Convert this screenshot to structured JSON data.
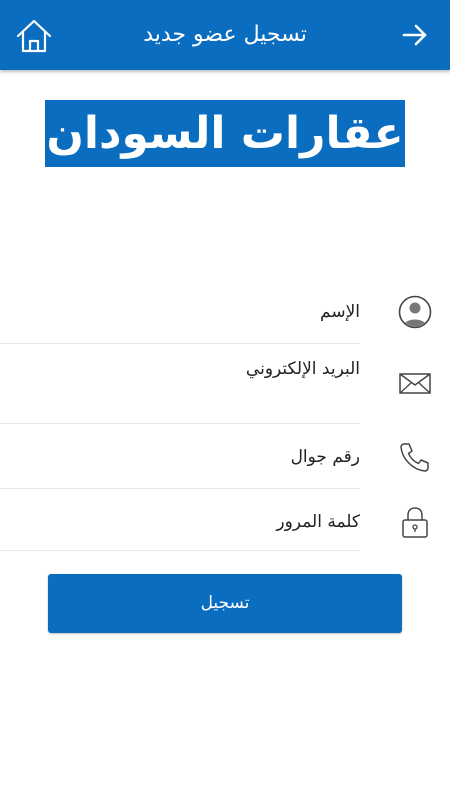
{
  "header": {
    "title": "تسجيل عضو جديد",
    "home_icon": "home-icon",
    "back_icon": "arrow-right-icon",
    "background_color": "#0a6dbf"
  },
  "logo": {
    "text": "عقارات السودان"
  },
  "form": {
    "name_label": "الإسم",
    "email_label": "البريد الإلكتروني",
    "phone_label": "رقم جوال",
    "password_label": "كلمة المرور",
    "icons": {
      "name": "person-avatar-icon",
      "email": "envelope-icon",
      "phone": "phone-icon",
      "password": "padlock-icon"
    }
  },
  "submit": {
    "label": "تسجيل"
  }
}
